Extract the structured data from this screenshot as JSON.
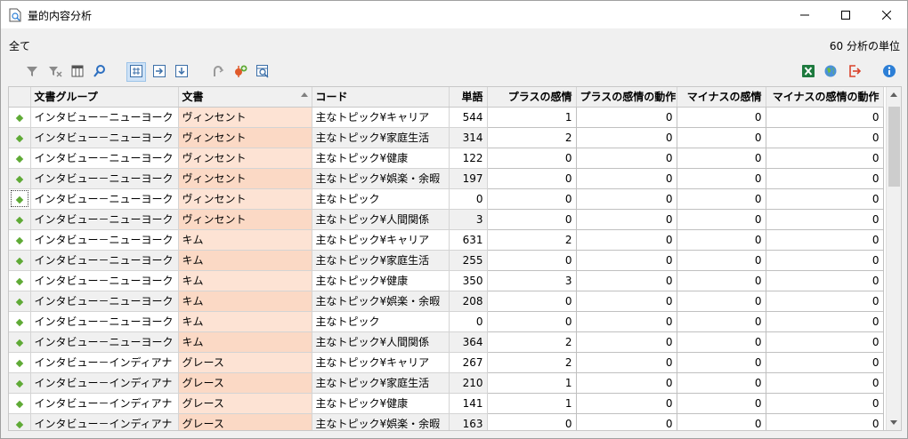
{
  "window": {
    "title": "量的内容分析",
    "controls": {
      "minimize": "minimize-icon",
      "maximize": "maximize-icon",
      "close": "close-icon"
    }
  },
  "header": {
    "scope": "全て",
    "unit_count": "60 分析の単位"
  },
  "toolbar": {
    "left": [
      "filter-icon",
      "clear-filter-icon",
      "columns-icon",
      "search-icon",
      "hash-icon",
      "export-right-icon",
      "export-down-icon",
      "link-icon",
      "add-code-icon",
      "find-table-icon"
    ],
    "right": [
      "excel-icon",
      "globe-icon",
      "exit-icon",
      "info-icon"
    ]
  },
  "colors": {
    "accent": "#5faa36",
    "doc_highlight": "#fde3d4",
    "excel_green": "#1d7a3e",
    "exit_red": "#d9422b",
    "info_blue": "#2d7fd6"
  },
  "table": {
    "columns": [
      "文書グループ",
      "文書",
      "コード",
      "単語",
      "プラスの感情",
      "プラスの感情の動作",
      "マイナスの感情",
      "マイナスの感情の動作"
    ],
    "rows": [
      [
        "インタビュー－ニューヨーク",
        "ヴィンセント",
        "主なトピック¥キャリア",
        "544",
        "1",
        "0",
        "0",
        "0"
      ],
      [
        "インタビュー－ニューヨーク",
        "ヴィンセント",
        "主なトピック¥家庭生活",
        "314",
        "2",
        "0",
        "0",
        "0"
      ],
      [
        "インタビュー－ニューヨーク",
        "ヴィンセント",
        "主なトピック¥健康",
        "122",
        "0",
        "0",
        "0",
        "0"
      ],
      [
        "インタビュー－ニューヨーク",
        "ヴィンセント",
        "主なトピック¥娯楽・余暇",
        "197",
        "0",
        "0",
        "0",
        "0"
      ],
      [
        "インタビュー－ニューヨーク",
        "ヴィンセント",
        "主なトピック",
        "0",
        "0",
        "0",
        "0",
        "0"
      ],
      [
        "インタビュー－ニューヨーク",
        "ヴィンセント",
        "主なトピック¥人間関係",
        "3",
        "0",
        "0",
        "0",
        "0"
      ],
      [
        "インタビュー－ニューヨーク",
        "キム",
        "主なトピック¥キャリア",
        "631",
        "2",
        "0",
        "0",
        "0"
      ],
      [
        "インタビュー－ニューヨーク",
        "キム",
        "主なトピック¥家庭生活",
        "255",
        "0",
        "0",
        "0",
        "0"
      ],
      [
        "インタビュー－ニューヨーク",
        "キム",
        "主なトピック¥健康",
        "350",
        "3",
        "0",
        "0",
        "0"
      ],
      [
        "インタビュー－ニューヨーク",
        "キム",
        "主なトピック¥娯楽・余暇",
        "208",
        "0",
        "0",
        "0",
        "0"
      ],
      [
        "インタビュー－ニューヨーク",
        "キム",
        "主なトピック",
        "0",
        "0",
        "0",
        "0",
        "0"
      ],
      [
        "インタビュー－ニューヨーク",
        "キム",
        "主なトピック¥人間関係",
        "364",
        "2",
        "0",
        "0",
        "0"
      ],
      [
        "インタビュー－インディアナ",
        "グレース",
        "主なトピック¥キャリア",
        "267",
        "2",
        "0",
        "0",
        "0"
      ],
      [
        "インタビュー－インディアナ",
        "グレース",
        "主なトピック¥家庭生活",
        "210",
        "1",
        "0",
        "0",
        "0"
      ],
      [
        "インタビュー－インディアナ",
        "グレース",
        "主なトピック¥健康",
        "141",
        "1",
        "0",
        "0",
        "0"
      ],
      [
        "インタビュー－インディアナ",
        "グレース",
        "主なトピック¥娯楽・余暇",
        "163",
        "0",
        "0",
        "0",
        "0"
      ]
    ]
  }
}
